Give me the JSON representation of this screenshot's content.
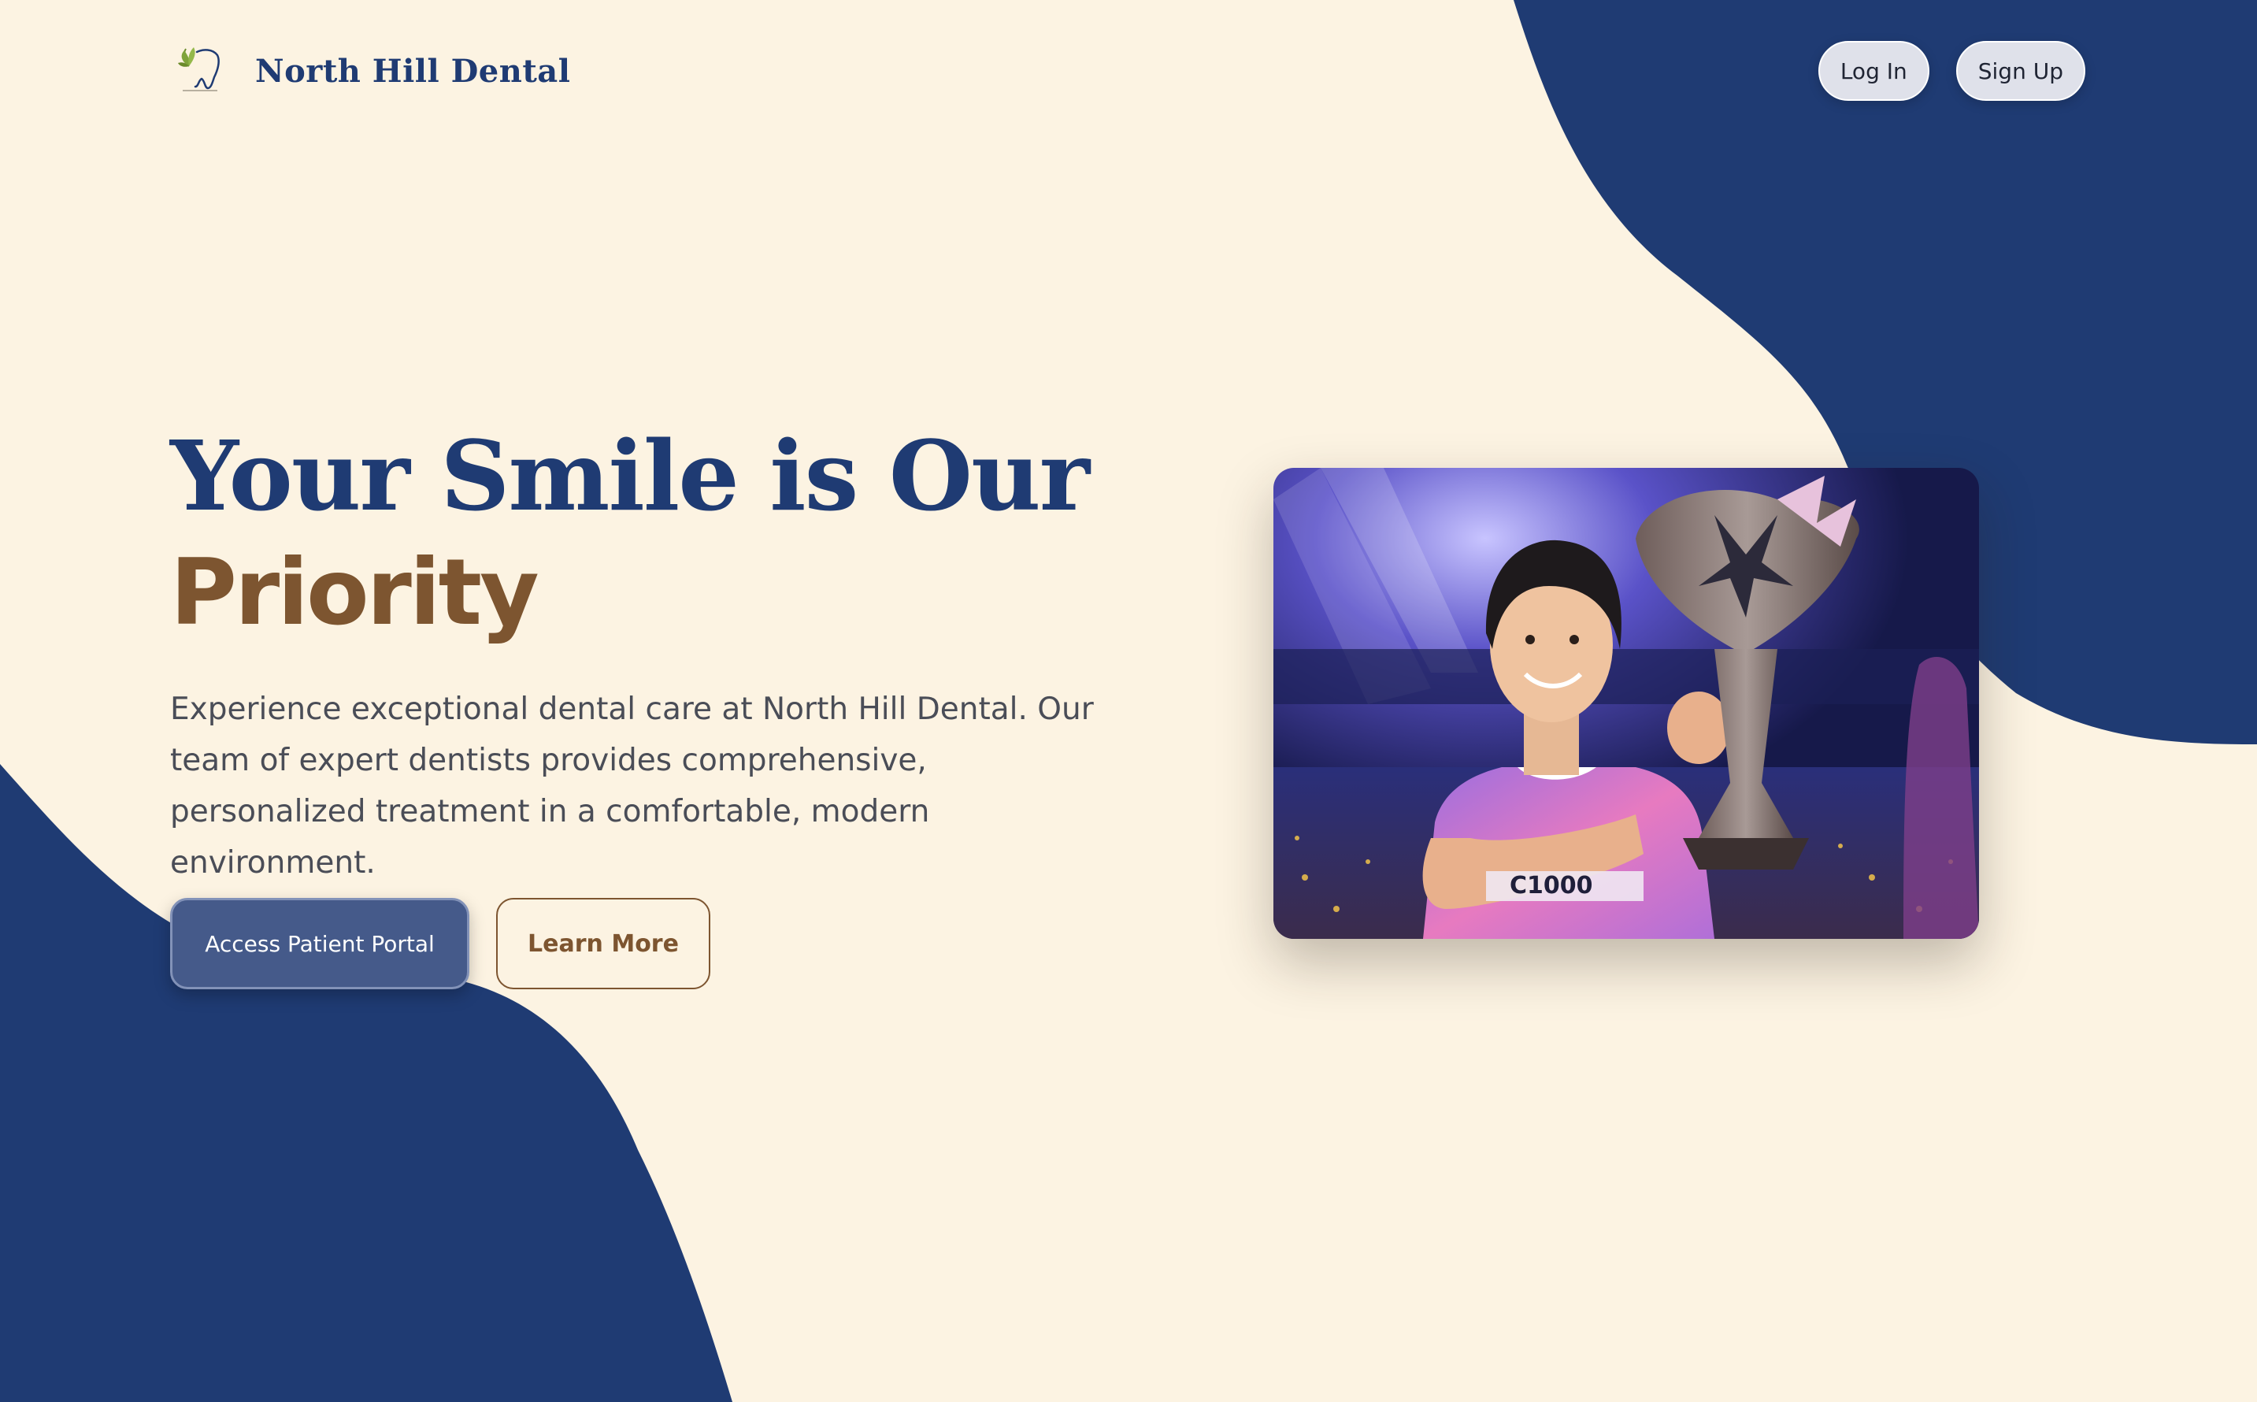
{
  "brand": {
    "name": "North Hill Dental"
  },
  "auth": {
    "login_label": "Log In",
    "signup_label": "Sign Up"
  },
  "hero": {
    "title_line1": "Your Smile is Our",
    "title_line2": "Priority",
    "description": "Experience exceptional dental care at North Hill Dental. Our team of expert dentists provides comprehensive, personalized treatment in a comfortable, modern environment.",
    "primary_cta": "Access Patient Portal",
    "secondary_cta": "Learn More"
  },
  "photo": {
    "jersey_text": "C1000"
  },
  "colors": {
    "background": "#fcf3e2",
    "navy": "#1f3b73",
    "brown": "#7d5530",
    "button_fill": "#455a8a"
  },
  "icons": {
    "logo": "tooth-leaf-logo"
  }
}
